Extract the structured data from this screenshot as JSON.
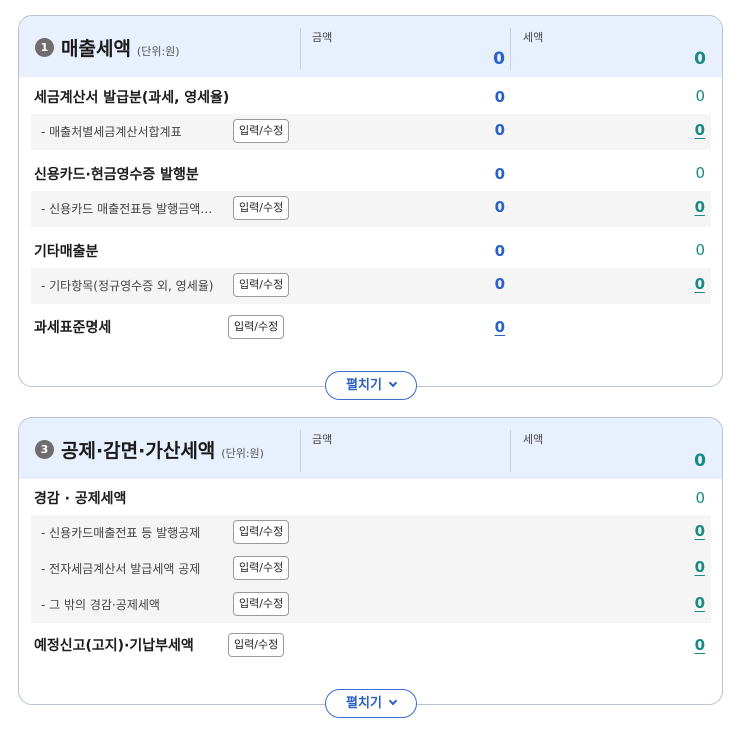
{
  "sales": {
    "badge": "1",
    "title": "매출세액",
    "unit": "(단위:원)",
    "col_amount": "금액",
    "col_tax": "세액",
    "total_amount": "0",
    "total_tax": "0",
    "rows": [
      {
        "label": "세금계산서 발급분(과세, 영세율)",
        "amount": "0",
        "tax": "0"
      },
      {
        "label": "- 매출처별세금계산서합계표",
        "button": "입력/수정",
        "amount": "0",
        "tax": "0"
      },
      {
        "label": "신용카드·현금영수증 발행분",
        "amount": "0",
        "tax": "0"
      },
      {
        "label": "- 신용카드 매출전표등 발행금액…",
        "button": "입력/수정",
        "amount": "0",
        "tax": "0"
      },
      {
        "label": "기타매출분",
        "amount": "0",
        "tax": "0"
      },
      {
        "label": "- 기타항목(정규영수증 외, 영세율)",
        "button": "입력/수정",
        "amount": "0",
        "tax": "0"
      },
      {
        "label": "과세표준명세",
        "button": "입력/수정",
        "amount": "0"
      }
    ],
    "expand_label": "펼치기"
  },
  "deduction": {
    "badge": "3",
    "title": "공제·감면·가산세액",
    "unit": "(단위:원)",
    "col_amount": "금액",
    "col_tax": "세액",
    "total_tax": "0",
    "rows": [
      {
        "label": "경감 · 공제세액",
        "tax": "0"
      },
      {
        "label": "- 신용카드매출전표 등 발행공제",
        "button": "입력/수정",
        "tax": "0"
      },
      {
        "label": "- 전자세금계산서 발급세액 공제",
        "button": "입력/수정",
        "tax": "0"
      },
      {
        "label": "- 그 밖의 경감·공제세액",
        "button": "입력/수정",
        "tax": "0"
      },
      {
        "label": "예정신고(고지)·기납부세액",
        "button": "입력/수정",
        "tax": "0"
      }
    ],
    "expand_label": "펼치기"
  },
  "colors": {
    "amount": "#2a62c9",
    "tax": "#1a8a84",
    "header_bg": "#e8effd"
  },
  "icons": {
    "expand": "chevron-down-icon"
  }
}
